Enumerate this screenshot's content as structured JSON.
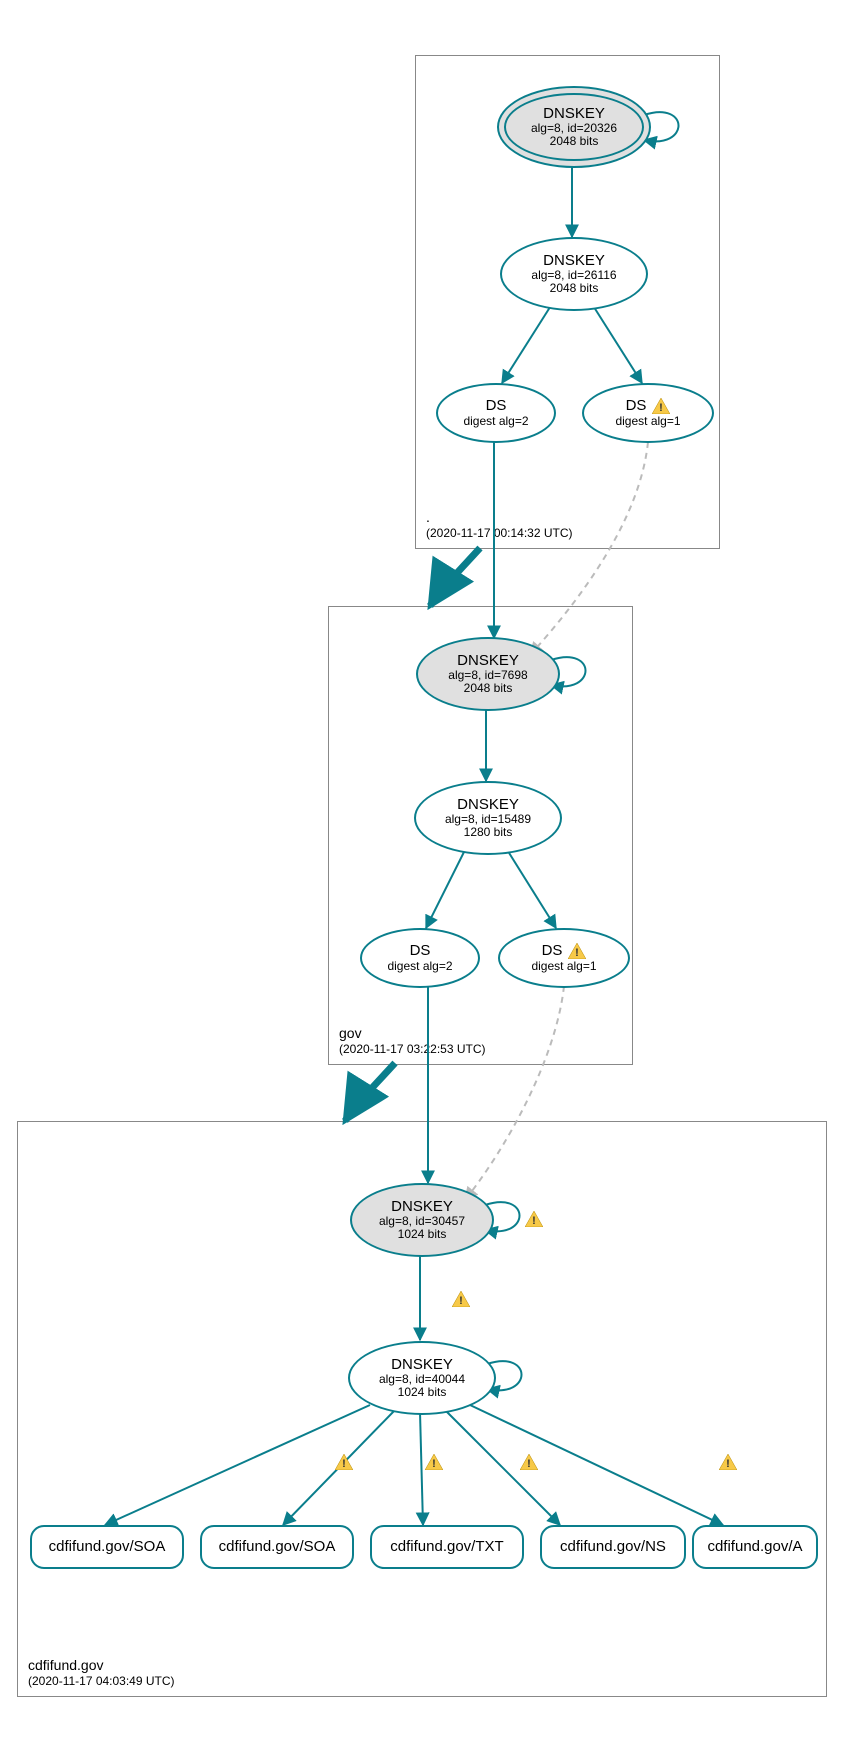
{
  "zones": {
    "root": {
      "name": ".",
      "timestamp": "(2020-11-17 00:14:32 UTC)"
    },
    "gov": {
      "name": "gov",
      "timestamp": "(2020-11-17 03:22:53 UTC)"
    },
    "leaf": {
      "name": "cdfifund.gov",
      "timestamp": "(2020-11-17 04:03:49 UTC)"
    }
  },
  "nodes": {
    "root_ksk": {
      "title": "DNSKEY",
      "sub1": "alg=8, id=20326",
      "sub2": "2048 bits"
    },
    "root_zsk": {
      "title": "DNSKEY",
      "sub1": "alg=8, id=26116",
      "sub2": "2048 bits"
    },
    "root_ds2": {
      "title": "DS",
      "sub1": "digest alg=2"
    },
    "root_ds1": {
      "title": "DS",
      "sub1": "digest alg=1"
    },
    "gov_ksk": {
      "title": "DNSKEY",
      "sub1": "alg=8, id=7698",
      "sub2": "2048 bits"
    },
    "gov_zsk": {
      "title": "DNSKEY",
      "sub1": "alg=8, id=15489",
      "sub2": "1280 bits"
    },
    "gov_ds2": {
      "title": "DS",
      "sub1": "digest alg=2"
    },
    "gov_ds1": {
      "title": "DS",
      "sub1": "digest alg=1"
    },
    "leaf_ksk": {
      "title": "DNSKEY",
      "sub1": "alg=8, id=30457",
      "sub2": "1024 bits"
    },
    "leaf_zsk": {
      "title": "DNSKEY",
      "sub1": "alg=8, id=40044",
      "sub2": "1024 bits"
    },
    "rr0": {
      "label": "cdfifund.gov/SOA"
    },
    "rr1": {
      "label": "cdfifund.gov/SOA"
    },
    "rr2": {
      "label": "cdfifund.gov/TXT"
    },
    "rr3": {
      "label": "cdfifund.gov/NS"
    },
    "rr4": {
      "label": "cdfifund.gov/A"
    }
  }
}
